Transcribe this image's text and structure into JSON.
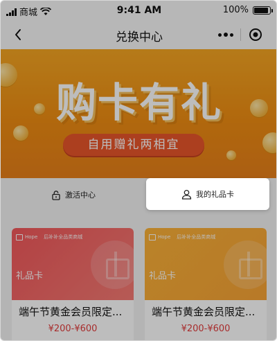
{
  "status_bar": {
    "carrier": "商城",
    "time": "9:41 AM",
    "battery_text": "100%",
    "battery_level": 1.0
  },
  "nav": {
    "title": "兑换中心",
    "back_icon": "chevron-left-icon",
    "more_icon": "more-dots-icon",
    "close_icon": "target-circle-icon"
  },
  "banner": {
    "title": "购卡有礼",
    "subtitle": "自用赠礼两相宜"
  },
  "tabs": [
    {
      "label": "激活中心",
      "icon": "lock-icon",
      "active": false
    },
    {
      "label": "我的礼品卡",
      "icon": "user-icon",
      "active": true
    }
  ],
  "cards": [
    {
      "brand": "Hope",
      "store": "后补补全品类商城",
      "type": "礼品卡",
      "name": "端午节黄金会员限定...",
      "price": "¥200-¥600",
      "color": "#f2585b"
    },
    {
      "brand": "Hope",
      "store": "后补补全品类商城",
      "type": "礼品卡",
      "name": "端午节黄金会员限定...",
      "price": "¥200-¥600",
      "color": "#fbb238"
    }
  ],
  "colors": {
    "accent": "#e23b3b",
    "banner": "#f5a623",
    "banner_pill": "#e9552b"
  }
}
